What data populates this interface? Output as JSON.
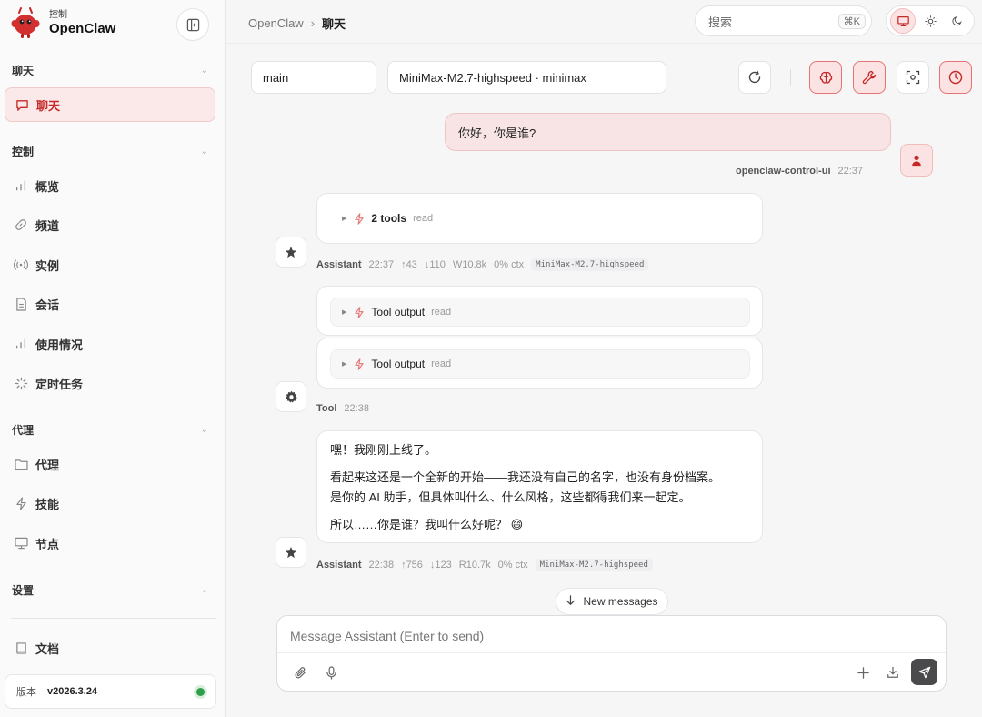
{
  "brand": {
    "sub": "控制",
    "name": "OpenClaw"
  },
  "sidebar": {
    "sections": [
      {
        "label": "聊天",
        "items": [
          {
            "label": "聊天",
            "icon": "chat-bubble-icon",
            "active": true
          }
        ]
      },
      {
        "label": "控制",
        "items": [
          {
            "label": "概览",
            "icon": "bar-chart-icon"
          },
          {
            "label": "频道",
            "icon": "link-icon"
          },
          {
            "label": "实例",
            "icon": "radio-signal-icon"
          },
          {
            "label": "会话",
            "icon": "document-icon"
          },
          {
            "label": "使用情况",
            "icon": "bar-chart-icon"
          },
          {
            "label": "定时任务",
            "icon": "loader-icon"
          }
        ]
      },
      {
        "label": "代理",
        "items": [
          {
            "label": "代理",
            "icon": "folder-icon"
          },
          {
            "label": "技能",
            "icon": "lightning-icon"
          },
          {
            "label": "节点",
            "icon": "monitor-icon"
          }
        ]
      },
      {
        "label": "设置",
        "items": []
      }
    ],
    "docs_label": "文档",
    "version_label": "版本",
    "version": "v2026.3.24",
    "status_color": "#2e9e4a"
  },
  "header": {
    "breadcrumb_root": "OpenClaw",
    "breadcrumb_sep": "›",
    "breadcrumb_current": "聊天",
    "search_placeholder": "搜索",
    "search_shortcut": "⌘K"
  },
  "toolbar": {
    "session": "main",
    "model": "MiniMax-M2.7-highspeed · minimax"
  },
  "messages": {
    "user": {
      "text": "你好，你是谁?",
      "sender": "openclaw-control-ui",
      "time": "22:37"
    },
    "tools_summary": {
      "label": "2 tools",
      "tag": "read"
    },
    "assistant1_meta": {
      "who": "Assistant",
      "time": "22:37",
      "up": "↑43",
      "down": "↓110",
      "cache": "W10.8k",
      "ctx": "0% ctx",
      "model": "MiniMax-M2.7-highspeed"
    },
    "tool_outputs": [
      {
        "label": "Tool output",
        "tag": "read"
      },
      {
        "label": "Tool output",
        "tag": "read"
      }
    ],
    "tool_meta": {
      "who": "Tool",
      "time": "22:38"
    },
    "assistant_reply": {
      "p1": "嘿！我刚刚上线了。",
      "p2": "看起来这还是一个全新的开始——我还没有自己的名字，也没有身份档案。",
      "p3": "是你的 AI 助手，但具体叫什么、什么风格，这些都得我们来一起定。",
      "p4": "所以……你是谁？我叫什么好呢？ 😄"
    },
    "assistant2_meta": {
      "who": "Assistant",
      "time": "22:38",
      "up": "↑756",
      "down": "↓123",
      "cache": "R10.7k",
      "ctx": "0% ctx",
      "model": "MiniMax-M2.7-highspeed"
    }
  },
  "new_messages_label": "New messages",
  "composer": {
    "placeholder": "Message Assistant (Enter to send)",
    "value": ""
  },
  "colors": {
    "accent": "#c62828",
    "accent_bg": "#fbe3e3"
  }
}
